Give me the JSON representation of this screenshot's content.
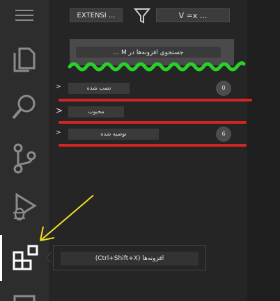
{
  "activity_bar": {
    "items": [
      {
        "icon": "menu-icon"
      },
      {
        "icon": "files-icon"
      },
      {
        "icon": "search-icon"
      },
      {
        "icon": "source-control-icon"
      },
      {
        "icon": "run-debug-icon"
      },
      {
        "icon": "extensions-icon",
        "active": true
      },
      {
        "icon": "panel-icon"
      }
    ]
  },
  "header": {
    "view_label": "EXTENSI ...",
    "filter_icon": "filter-icon",
    "sort_label": "V =x ..."
  },
  "search": {
    "placeholder": "جستجوی افزونه‌ها در M ..."
  },
  "sections": [
    {
      "label": "نصب شده",
      "count": "0"
    },
    {
      "label": "محبوب",
      "count": ""
    },
    {
      "label": "توصیه شده",
      "count": "6"
    }
  ],
  "tooltip": {
    "text": "افزونه‌ها (Ctrl+Shift+X)"
  },
  "colors": {
    "annotation_green": "#28d228",
    "annotation_red": "#d42525",
    "annotation_yellow": "#f0e020",
    "activity_bar_bg": "#2d2d2d",
    "sidebar_bg": "#252526"
  }
}
